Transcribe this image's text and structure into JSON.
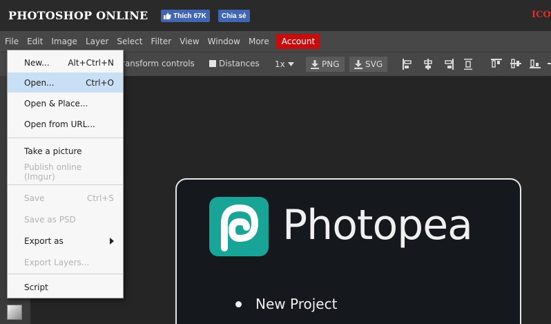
{
  "header": {
    "site_title": "PHOTOSHOP ONLINE",
    "fb_like_label": "Thích 67K",
    "fb_share_label": "Chia sẻ",
    "right_text": "ICO"
  },
  "menubar": {
    "items": [
      "File",
      "Edit",
      "Image",
      "Layer",
      "Select",
      "Filter",
      "View",
      "Window",
      "More"
    ],
    "account_label": "Account"
  },
  "toolbar": {
    "transform_label": "ransform controls",
    "distances_label": "Distances",
    "zoom_value": "1x",
    "png_label": "PNG",
    "svg_label": "SVG"
  },
  "file_menu": {
    "items": [
      {
        "label": "New...",
        "shortcut": "Alt+Ctrl+N"
      },
      {
        "label": "Open...",
        "shortcut": "Ctrl+O"
      },
      {
        "label": "Open & Place...",
        "shortcut": ""
      },
      {
        "label": "Open from URL...",
        "shortcut": ""
      },
      {
        "label": "Take a picture",
        "shortcut": ""
      },
      {
        "label": "Publish online (Imgur)",
        "shortcut": ""
      },
      {
        "label": "Save",
        "shortcut": "Ctrl+S"
      },
      {
        "label": "Save as PSD",
        "shortcut": ""
      },
      {
        "label": "Export as",
        "shortcut": ""
      },
      {
        "label": "Export Layers...",
        "shortcut": ""
      },
      {
        "label": "Script",
        "shortcut": ""
      }
    ],
    "highlighted_item": "Open..."
  },
  "welcome": {
    "brand_name": "Photopea",
    "list": [
      "New Project"
    ]
  },
  "colors": {
    "account_red": "#c50e10",
    "facebook_blue": "#4267b2",
    "photopea_teal": "#18a497",
    "menu_highlight": "#c8dff5"
  }
}
